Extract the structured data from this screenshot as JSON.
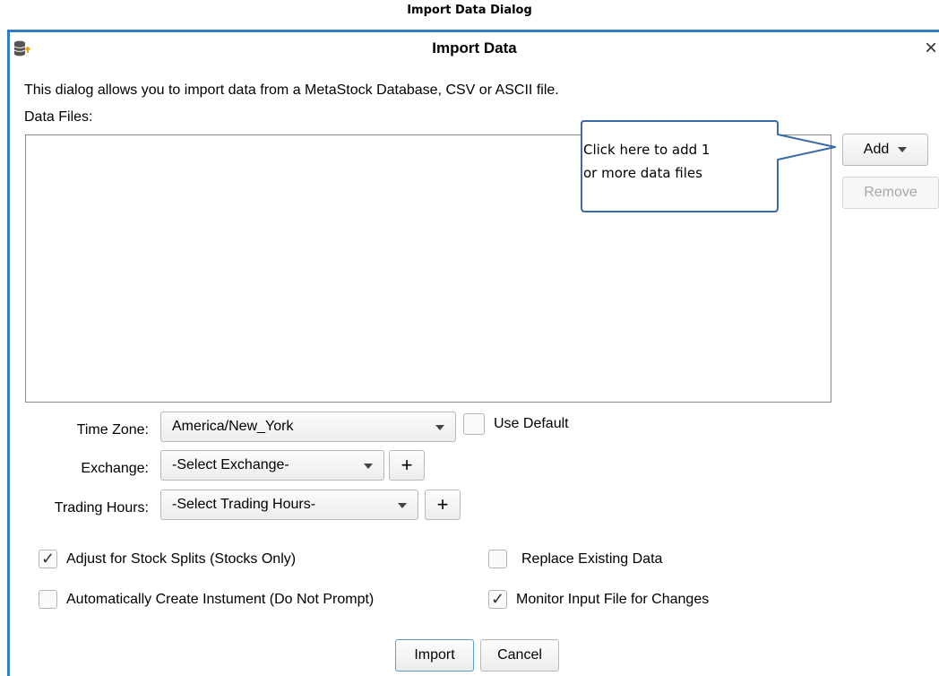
{
  "caption": "Import Data Dialog",
  "dialog": {
    "title": "Import Data",
    "close_glyph": "×",
    "description": "This dialog allows you to import data from a MetaStock Database, CSV or ASCII file.",
    "files_label": "Data Files:",
    "add_label": "Add",
    "remove_label": "Remove",
    "callout_line1": "Click here to add 1",
    "callout_line2": "or more data files",
    "time_zone_label": "Time Zone:",
    "time_zone_value": "America/New_York",
    "use_default_label": "Use Default",
    "exchange_label": "Exchange:",
    "exchange_value": "-Select Exchange-",
    "trading_hours_label": "Trading Hours:",
    "trading_hours_value": "-Select Trading Hours-",
    "plus_glyph": "+",
    "options": {
      "adjust_splits": {
        "label": "Adjust for Stock Splits (Stocks Only)",
        "checked": true
      },
      "auto_create": {
        "label": "Automatically Create Instument (Do Not Prompt)",
        "checked": false
      },
      "replace_existing": {
        "label": "Replace Existing Data",
        "checked": false
      },
      "monitor_input": {
        "label": "Monitor Input File for Changes",
        "checked": true
      }
    },
    "check_glyph": "✓",
    "import_label": "Import",
    "cancel_label": "Cancel"
  },
  "colors": {
    "window_border": "#2f7fc8",
    "callout_border": "#3a6aa8",
    "primary_border": "#5d9bd4"
  }
}
